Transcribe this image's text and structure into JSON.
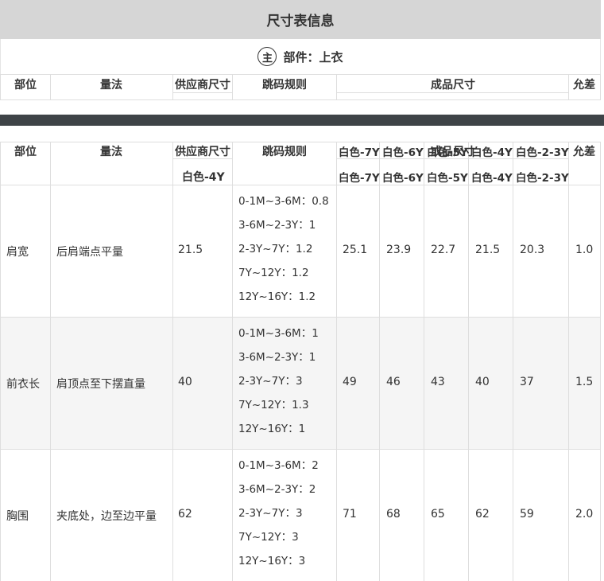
{
  "title": "尺寸表信息",
  "part": {
    "badge": "主",
    "label": "部件：上衣"
  },
  "header": {
    "position": "部位",
    "method": "量法",
    "supplier_size": "供应商尺寸",
    "grading_rule": "跳码规则",
    "finished_size": "成品尺寸",
    "tolerance": "允差"
  },
  "size_columns": [
    "白色-7Y",
    "白色-6Y",
    "白色-5Y",
    "白色-4Y",
    "白色-2-3Y"
  ],
  "supplier_size_column": "白色-4Y",
  "rows": [
    {
      "position": "肩宽",
      "method": "后肩端点平量",
      "supplier": "21.5",
      "rules": [
        "0-1M~3-6M：0.8",
        "3-6M~2-3Y：1",
        "2-3Y~7Y：1.2",
        "7Y~12Y：1.2",
        "12Y~16Y：1.2"
      ],
      "sizes": [
        "25.1",
        "23.9",
        "22.7",
        "21.5",
        "20.3"
      ],
      "tolerance": "1.0"
    },
    {
      "position": "前衣长",
      "method": "肩顶点至下摆直量",
      "supplier": "40",
      "rules": [
        "0-1M~3-6M：1",
        "3-6M~2-3Y：1",
        "2-3Y~7Y：3",
        "7Y~12Y：1.3",
        "12Y~16Y：1"
      ],
      "sizes": [
        "49",
        "46",
        "43",
        "40",
        "37"
      ],
      "tolerance": "1.5"
    },
    {
      "position": "胸围",
      "method": "夹底处，边至边平量",
      "supplier": "62",
      "rules": [
        "0-1M~3-6M：2",
        "3-6M~2-3Y：2",
        "2-3Y~7Y：3",
        "7Y~12Y：3",
        "12Y~16Y：3"
      ],
      "sizes": [
        "71",
        "68",
        "65",
        "62",
        "59"
      ],
      "tolerance": "2.0"
    }
  ]
}
